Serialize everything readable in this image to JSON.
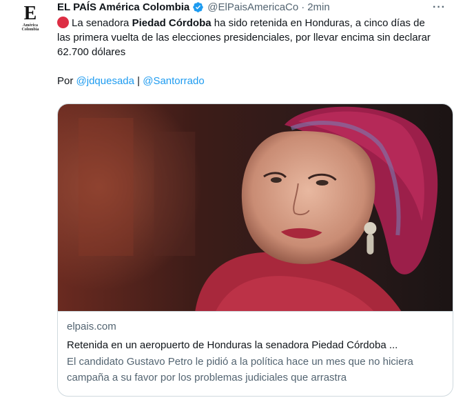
{
  "avatar": {
    "letter": "E",
    "sub_line1": "América",
    "sub_line2": "Colombia"
  },
  "tweet": {
    "author_name": "EL PAÍS América Colombia",
    "handle": "@ElPaisAmericaCo",
    "separator": "·",
    "time": "2min",
    "more_label": "···",
    "text_before": "La senadora ",
    "text_bold": "Piedad Córdoba",
    "text_after": " ha sido retenida en Honduras, a cinco días de las primera vuelta de las elecciones presidenciales, por llevar encima sin declarar 62.700 dólares",
    "credit_prefix": "Por ",
    "credit_mention_1": "@jdquesada",
    "credit_separator": " | ",
    "credit_mention_2": "@Santorrado"
  },
  "card": {
    "domain": "elpais.com",
    "title": "Retenida en un aeropuerto de Honduras la senadora Piedad Córdoba ...",
    "description": "El candidato Gustavo Petro le pidió a la política hace un mes que no hiciera campaña a su favor por los problemas judiciales que arrastra"
  },
  "colors": {
    "text": "#0f1419",
    "secondary": "#536471",
    "link": "#1d9bf0",
    "verified": "#1d9bf0",
    "alert_circle": "#dd2e44",
    "border": "#cfd9de"
  },
  "icons": {
    "verified": "verified-badge-icon",
    "alert": "red-circle-emoji",
    "more": "more-options-icon"
  }
}
